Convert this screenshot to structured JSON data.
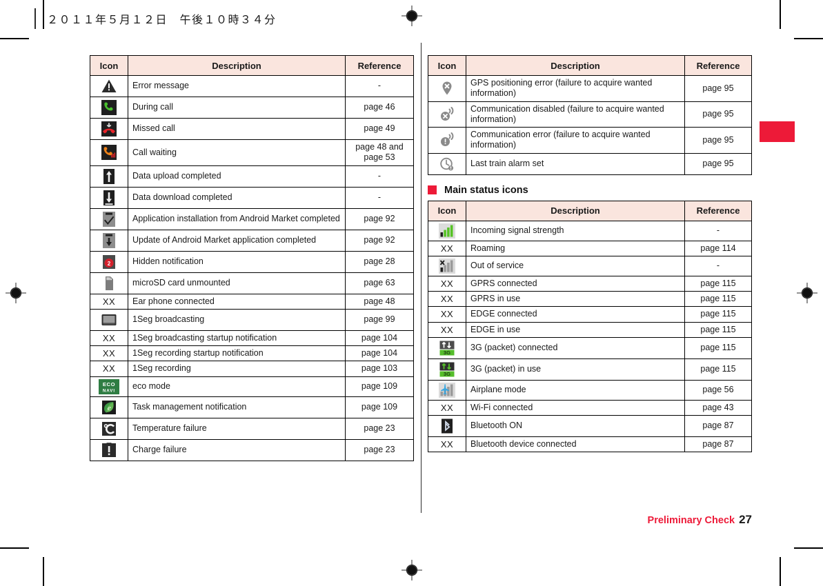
{
  "header": {
    "date_text": "２０１１年５月１２日　午後１０時３４分"
  },
  "colors": {
    "table_header_bg": "#fae5de",
    "accent_red": "#ed1a38",
    "border": "#000000"
  },
  "table_columns": {
    "icon": "Icon",
    "description": "Description",
    "reference": "Reference"
  },
  "left_table": {
    "rows": [
      {
        "icon": "warning-triangle-icon",
        "icon_text": "",
        "description": "Error message",
        "reference": "-"
      },
      {
        "icon": "during-call-icon",
        "icon_text": "",
        "description": "During call",
        "reference": "page 46"
      },
      {
        "icon": "missed-call-icon",
        "icon_text": "",
        "description": "Missed call",
        "reference": "page 49"
      },
      {
        "icon": "call-waiting-icon",
        "icon_text": "",
        "description": "Call waiting",
        "reference": "page 48 and page 53"
      },
      {
        "icon": "upload-arrow-icon",
        "icon_text": "",
        "description": "Data upload completed",
        "reference": "-"
      },
      {
        "icon": "download-arrow-icon",
        "icon_text": "",
        "description": "Data download completed",
        "reference": "-"
      },
      {
        "icon": "install-check-icon",
        "icon_text": "",
        "description": "Application installation from Android Market completed",
        "reference": "page 92"
      },
      {
        "icon": "update-download-icon",
        "icon_text": "",
        "description": "Update of Android Market application completed",
        "reference": "page 92"
      },
      {
        "icon": "hidden-notification-icon",
        "icon_text": "",
        "description": "Hidden notification",
        "reference": "page 28"
      },
      {
        "icon": "microsd-card-icon",
        "icon_text": "",
        "description": "microSD card unmounted",
        "reference": "page 63"
      },
      {
        "icon": "placeholder-icon",
        "icon_text": "XX",
        "description": "Ear phone connected",
        "reference": "page 48"
      },
      {
        "icon": "tv-screen-icon",
        "icon_text": "",
        "description": "1Seg broadcasting",
        "reference": "page 99"
      },
      {
        "icon": "placeholder-icon",
        "icon_text": "XX",
        "description": "1Seg broadcasting startup notification",
        "reference": "page 104"
      },
      {
        "icon": "placeholder-icon",
        "icon_text": "XX",
        "description": "1Seg recording startup notification",
        "reference": "page 104"
      },
      {
        "icon": "placeholder-icon",
        "icon_text": "XX",
        "description": "1Seg recording",
        "reference": "page 103"
      },
      {
        "icon": "eco-navi-icon",
        "icon_text": "",
        "description": "eco mode",
        "reference": "page 109"
      },
      {
        "icon": "eco-leaf-icon",
        "icon_text": "",
        "description": "Task management notification",
        "reference": "page 109"
      },
      {
        "icon": "temperature-icon",
        "icon_text": "",
        "description": "Temperature failure",
        "reference": "page 23"
      },
      {
        "icon": "charge-failure-icon",
        "icon_text": "",
        "description": "Charge failure",
        "reference": "page 23"
      }
    ]
  },
  "right_table_top": {
    "rows": [
      {
        "icon": "gps-error-pin-icon",
        "icon_text": "",
        "description": "GPS positioning error (failure to acquire wanted information)",
        "reference": "page 95"
      },
      {
        "icon": "communication-disabled-icon",
        "icon_text": "",
        "description": "Communication disabled (failure to acquire wanted information)",
        "reference": "page 95"
      },
      {
        "icon": "communication-error-icon",
        "icon_text": "",
        "description": "Communication error (failure to acquire wanted information)",
        "reference": "page 95"
      },
      {
        "icon": "last-train-alarm-icon",
        "icon_text": "",
        "description": "Last train alarm set",
        "reference": "page 95"
      }
    ]
  },
  "section_heading": {
    "label": "Main status icons"
  },
  "right_table_bottom": {
    "rows": [
      {
        "icon": "signal-strength-icon",
        "icon_text": "",
        "description": "Incoming signal strength",
        "reference": "-"
      },
      {
        "icon": "placeholder-icon",
        "icon_text": "XX",
        "description": "Roaming",
        "reference": "page 114"
      },
      {
        "icon": "out-of-service-icon",
        "icon_text": "",
        "description": "Out of service",
        "reference": "-"
      },
      {
        "icon": "placeholder-icon",
        "icon_text": "XX",
        "description": "GPRS connected",
        "reference": "page 115"
      },
      {
        "icon": "placeholder-icon",
        "icon_text": "XX",
        "description": "GPRS in use",
        "reference": "page 115"
      },
      {
        "icon": "placeholder-icon",
        "icon_text": "XX",
        "description": "EDGE connected",
        "reference": "page 115"
      },
      {
        "icon": "placeholder-icon",
        "icon_text": "XX",
        "description": "EDGE in use",
        "reference": "page 115"
      },
      {
        "icon": "3g-connected-icon",
        "icon_text": "",
        "description": "3G (packet) connected",
        "reference": "page 115"
      },
      {
        "icon": "3g-in-use-icon",
        "icon_text": "",
        "description": "3G (packet) in use",
        "reference": "page 115"
      },
      {
        "icon": "airplane-mode-icon",
        "icon_text": "",
        "description": "Airplane mode",
        "reference": "page 56"
      },
      {
        "icon": "placeholder-icon",
        "icon_text": "XX",
        "description": "Wi-Fi connected",
        "reference": "page 43"
      },
      {
        "icon": "bluetooth-on-icon",
        "icon_text": "",
        "description": "Bluetooth ON",
        "reference": "page 87"
      },
      {
        "icon": "placeholder-icon",
        "icon_text": "XX",
        "description": "Bluetooth device connected",
        "reference": "page 87"
      }
    ]
  },
  "footer": {
    "label": "Preliminary Check",
    "page_number": "27"
  }
}
